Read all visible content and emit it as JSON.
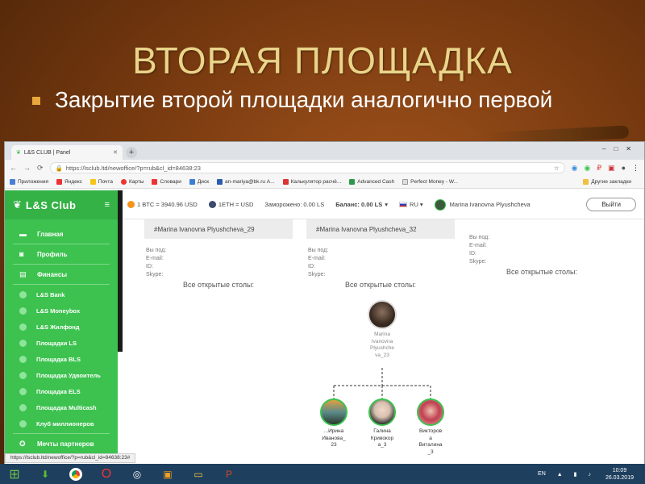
{
  "slide": {
    "title": "ВТОРАЯ ПЛОЩАДКА",
    "bullet": "Закрытие второй площадки аналогично первой"
  },
  "browser": {
    "tab_title": "L&S CLUB | Panel",
    "url": "https://lsclub.ltd/newoffice/?p=rub&cl_id=84638:23",
    "status_url": "https://lsclub.ltd/newoffice/?p=rub&cl_id=84638:23#",
    "bookmarks": [
      "Приложения",
      "Яндекс",
      "Почта",
      "Карты",
      "Словари",
      "Диск",
      "an-mariya@bk.ru А...",
      "Калькулятор расчё...",
      "Advanced Cash",
      "Perfect Money - W..."
    ],
    "bookmarks_other": "Другие закладки"
  },
  "app": {
    "logo": "L&S Club",
    "menu": {
      "home": "Главная",
      "profile": "Профиль",
      "finance": "Финансы",
      "finance_items": [
        "L&S Bank",
        "L&S Moneybox",
        "L&S Жилфонд",
        "Площадки LS",
        "Площадка BLS",
        "Площадка Удвоитель",
        "Площадка ELS",
        "Площадка Multicash",
        "Клуб миллионеров"
      ],
      "dreams": "Мечты партнеров"
    },
    "topbar": {
      "btc": "1 BTC = 3940.96 USD",
      "eth": "1ETH = USD",
      "frozen": "Заморожено: 0.00 LS",
      "balance": "Баланс: 0.00 LS",
      "lang": "RU",
      "user": "Marina Ivanovna Plyushcheva",
      "exit": "Выйти"
    },
    "columns": [
      {
        "header": "#Marina Ivanovna Plyushcheva_29",
        "fields": [
          "Вы под:",
          "E-mail:",
          "ID:",
          "Skype:"
        ],
        "tables": "Все открытые столы:"
      },
      {
        "header": "#Marina Ivanovna Plyushcheva_32",
        "fields": [
          "Вы под:",
          "E-mail:",
          "ID:",
          "Skype:"
        ],
        "tables": "Все открытые столы:"
      },
      {
        "header": "",
        "fields": [
          "Вы под:",
          "E-mail:",
          "ID:",
          "Skype:"
        ],
        "tables": "Все открытые столы:"
      }
    ],
    "tree": {
      "root": [
        "Marina",
        "Ivanovna",
        "Plyushche",
        "va_23"
      ],
      "children": [
        [
          "...Ирина",
          "Иванова_",
          "23"
        ],
        [
          "Галина",
          "Кривокор",
          "а_3"
        ],
        [
          "Викторов",
          "а",
          "Виталина",
          "_3"
        ]
      ]
    }
  },
  "taskbar": {
    "lang": "EN",
    "time": "10:09",
    "date": "26.03.2019"
  },
  "colors": {
    "sidebar_green": "#3dc24f",
    "title_gold": "#e9d48a"
  }
}
